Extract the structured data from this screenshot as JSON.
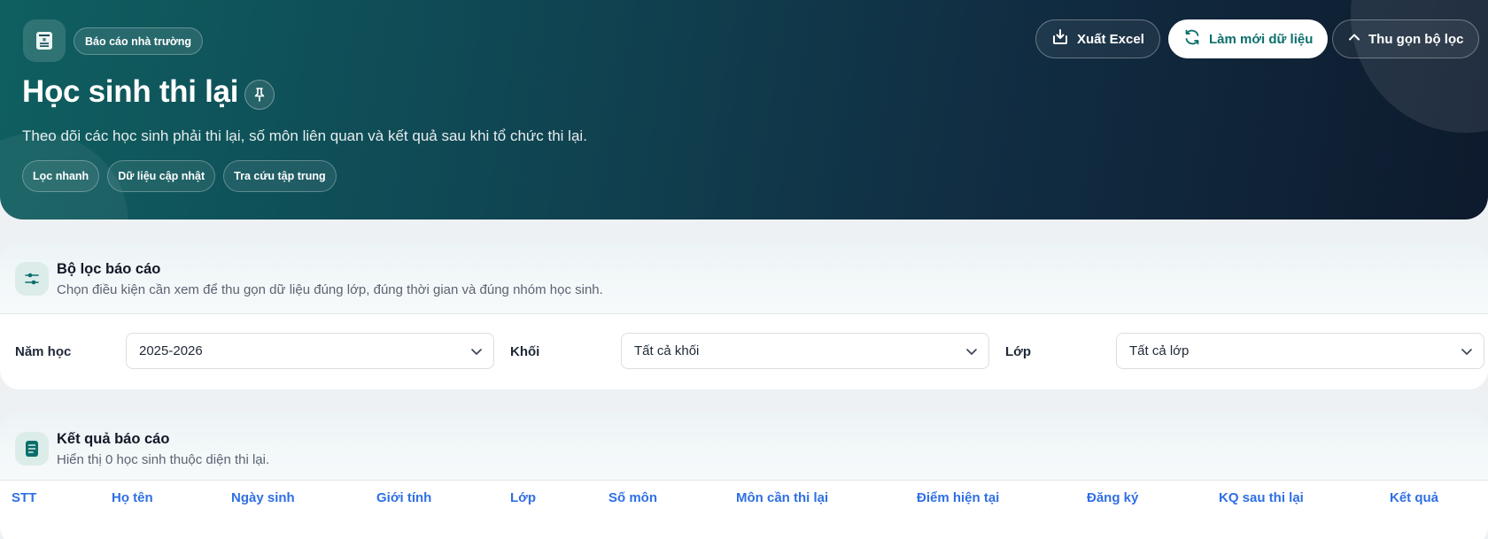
{
  "hero": {
    "badge": "Báo cáo nhà trường",
    "title": "Học sinh thi lại",
    "subtitle": "Theo dõi các học sinh phải thi lại, số môn liên quan và kết quả sau khi tổ chức thi lại.",
    "chips": [
      "Lọc nhanh",
      "Dữ liệu cập nhật",
      "Tra cứu tập trung"
    ],
    "buttons": {
      "export": "Xuất Excel",
      "refresh": "Làm mới dữ liệu",
      "collapse": "Thu gọn bộ lọc"
    },
    "icons": [
      "calculator-icon",
      "pin-icon",
      "download-icon",
      "refresh-icon",
      "chevron-up-icon"
    ]
  },
  "filter": {
    "title": "Bộ lọc báo cáo",
    "subtitle": "Chọn điều kiện cần xem để thu gọn dữ liệu đúng lớp, đúng thời gian và đúng nhóm học sinh.",
    "fields": [
      {
        "label": "Năm học",
        "value": "2025-2026"
      },
      {
        "label": "Khối",
        "value": "Tất cả khối"
      },
      {
        "label": "Lớp",
        "value": "Tất cả lớp"
      }
    ]
  },
  "result": {
    "title": "Kết quả báo cáo",
    "subtitle": "Hiển thị 0 học sinh thuộc diện thi lại.",
    "columns": [
      "STT",
      "Họ tên",
      "Ngày sinh",
      "Giới tính",
      "Lớp",
      "Số môn",
      "Môn cần thi lại",
      "Điểm hiện tại",
      "Đăng ký",
      "KQ sau thi lại",
      "Kết quả"
    ]
  },
  "colors": {
    "accent": "#0b6e6b",
    "header_link": "#2f6fe4",
    "hero_dark": "#0e1a2d"
  }
}
